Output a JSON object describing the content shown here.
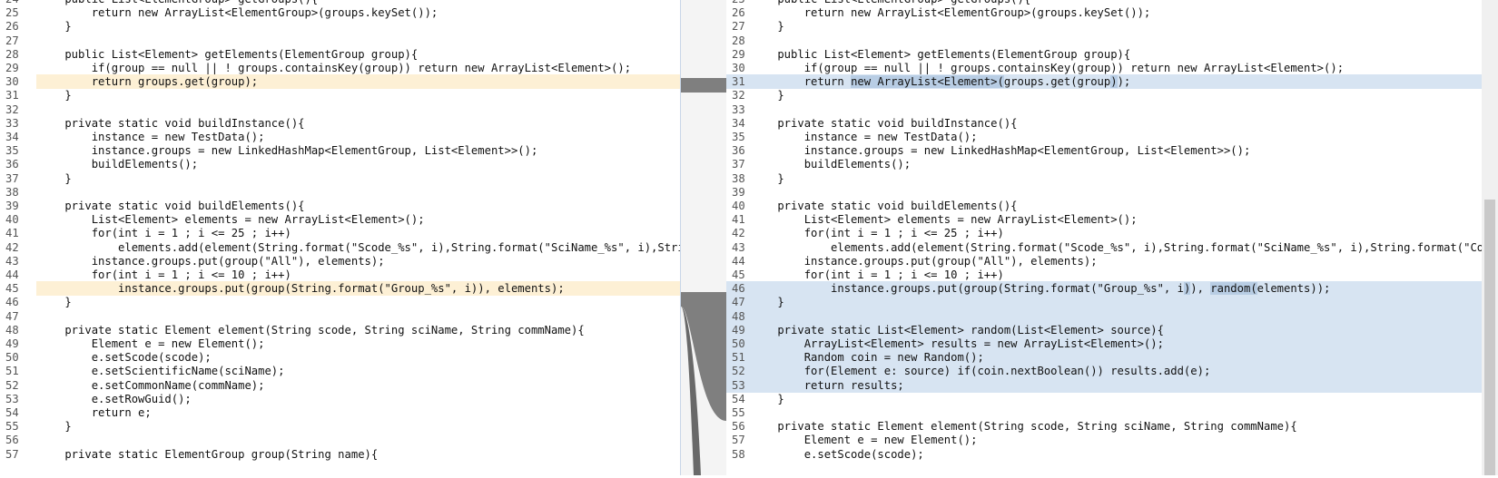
{
  "left": {
    "lines": [
      {
        "n": "24",
        "code": "    public List<ElementGroup> getGroups(){"
      },
      {
        "n": "25",
        "code": "        return new ArrayList<ElementGroup>(groups.keySet());"
      },
      {
        "n": "26",
        "code": "    }"
      },
      {
        "n": "27",
        "code": ""
      },
      {
        "n": "28",
        "code": "    public List<Element> getElements(ElementGroup group){"
      },
      {
        "n": "29",
        "code": "        if(group == null || ! groups.containsKey(group)) return new ArrayList<Element>();"
      },
      {
        "n": "30",
        "code": "        return groups.get(group);",
        "mod": true
      },
      {
        "n": "31",
        "code": "    }"
      },
      {
        "n": "32",
        "code": ""
      },
      {
        "n": "33",
        "code": "    private static void buildInstance(){"
      },
      {
        "n": "34",
        "code": "        instance = new TestData();"
      },
      {
        "n": "35",
        "code": "        instance.groups = new LinkedHashMap<ElementGroup, List<Element>>();"
      },
      {
        "n": "36",
        "code": "        buildElements();"
      },
      {
        "n": "37",
        "code": "    }"
      },
      {
        "n": "38",
        "code": ""
      },
      {
        "n": "39",
        "code": "    private static void buildElements(){"
      },
      {
        "n": "40",
        "code": "        List<Element> elements = new ArrayList<Element>();"
      },
      {
        "n": "41",
        "code": "        for(int i = 1 ; i <= 25 ; i++)"
      },
      {
        "n": "42",
        "code": "            elements.add(element(String.format(\"Scode_%s\", i),String.format(\"SciName_%s\", i),String.format(\"ComName_%s\", i)));"
      },
      {
        "n": "43",
        "code": "        instance.groups.put(group(\"All\"), elements);"
      },
      {
        "n": "44",
        "code": "        for(int i = 1 ; i <= 10 ; i++)"
      },
      {
        "n": "45",
        "code": "            instance.groups.put(group(String.format(\"Group_%s\", i)), elements);",
        "mod": true
      },
      {
        "n": "46",
        "code": "    }"
      },
      {
        "n": "47",
        "code": ""
      },
      {
        "n": "48",
        "code": "    private static Element element(String scode, String sciName, String commName){"
      },
      {
        "n": "49",
        "code": "        Element e = new Element();"
      },
      {
        "n": "50",
        "code": "        e.setScode(scode);"
      },
      {
        "n": "51",
        "code": "        e.setScientificName(sciName);"
      },
      {
        "n": "52",
        "code": "        e.setCommonName(commName);"
      },
      {
        "n": "53",
        "code": "        e.setRowGuid();"
      },
      {
        "n": "54",
        "code": "        return e;"
      },
      {
        "n": "55",
        "code": "    }"
      },
      {
        "n": "56",
        "code": ""
      },
      {
        "n": "57",
        "code": "    private static ElementGroup group(String name){"
      }
    ]
  },
  "right": {
    "lines": [
      {
        "n": "25",
        "code": "    public List<ElementGroup> getGroups(){"
      },
      {
        "n": "26",
        "code": "        return new ArrayList<ElementGroup>(groups.keySet());"
      },
      {
        "n": "27",
        "code": "    }"
      },
      {
        "n": "28",
        "code": ""
      },
      {
        "n": "29",
        "code": "    public List<Element> getElements(ElementGroup group){"
      },
      {
        "n": "30",
        "code": "        if(group == null || ! groups.containsKey(group)) return new ArrayList<Element>();"
      },
      {
        "n": "31",
        "code": "        return new ArrayList<Element>(groups.get(group));",
        "mod": true
      },
      {
        "n": "32",
        "code": "    }"
      },
      {
        "n": "33",
        "code": ""
      },
      {
        "n": "34",
        "code": "    private static void buildInstance(){"
      },
      {
        "n": "35",
        "code": "        instance = new TestData();"
      },
      {
        "n": "36",
        "code": "        instance.groups = new LinkedHashMap<ElementGroup, List<Element>>();"
      },
      {
        "n": "37",
        "code": "        buildElements();"
      },
      {
        "n": "38",
        "code": "    }"
      },
      {
        "n": "39",
        "code": ""
      },
      {
        "n": "40",
        "code": "    private static void buildElements(){"
      },
      {
        "n": "41",
        "code": "        List<Element> elements = new ArrayList<Element>();"
      },
      {
        "n": "42",
        "code": "        for(int i = 1 ; i <= 25 ; i++)"
      },
      {
        "n": "43",
        "code": "            elements.add(element(String.format(\"Scode_%s\", i),String.format(\"SciName_%s\", i),String.format(\"ComName_%s\", i)));"
      },
      {
        "n": "44",
        "code": "        instance.groups.put(group(\"All\"), elements);"
      },
      {
        "n": "45",
        "code": "        for(int i = 1 ; i <= 10 ; i++)"
      },
      {
        "n": "46",
        "code": "            instance.groups.put(group(String.format(\"Group_%s\", i)), random(elements));",
        "mod": true
      },
      {
        "n": "47",
        "code": "    }",
        "mod": true
      },
      {
        "n": "48",
        "code": "",
        "mod": true
      },
      {
        "n": "49",
        "code": "    private static List<Element> random(List<Element> source){",
        "mod": true
      },
      {
        "n": "50",
        "code": "        ArrayList<Element> results = new ArrayList<Element>();",
        "mod": true
      },
      {
        "n": "51",
        "code": "        Random coin = new Random();",
        "mod": true
      },
      {
        "n": "52",
        "code": "        for(Element e: source) if(coin.nextBoolean()) results.add(e);",
        "mod": true
      },
      {
        "n": "53",
        "code": "        return results;",
        "mod": true
      },
      {
        "n": "54",
        "code": "    }"
      },
      {
        "n": "55",
        "code": ""
      },
      {
        "n": "56",
        "code": "    private static Element element(String scode, String sciName, String commName){"
      },
      {
        "n": "57",
        "code": "        Element e = new Element();"
      },
      {
        "n": "58",
        "code": "        e.setScode(scode);"
      }
    ]
  },
  "colors": {
    "left_modified": "#fdf0d5",
    "right_modified": "#d7e4f2",
    "connector": "#7f7f7f",
    "highlight": "#b8cde4"
  }
}
